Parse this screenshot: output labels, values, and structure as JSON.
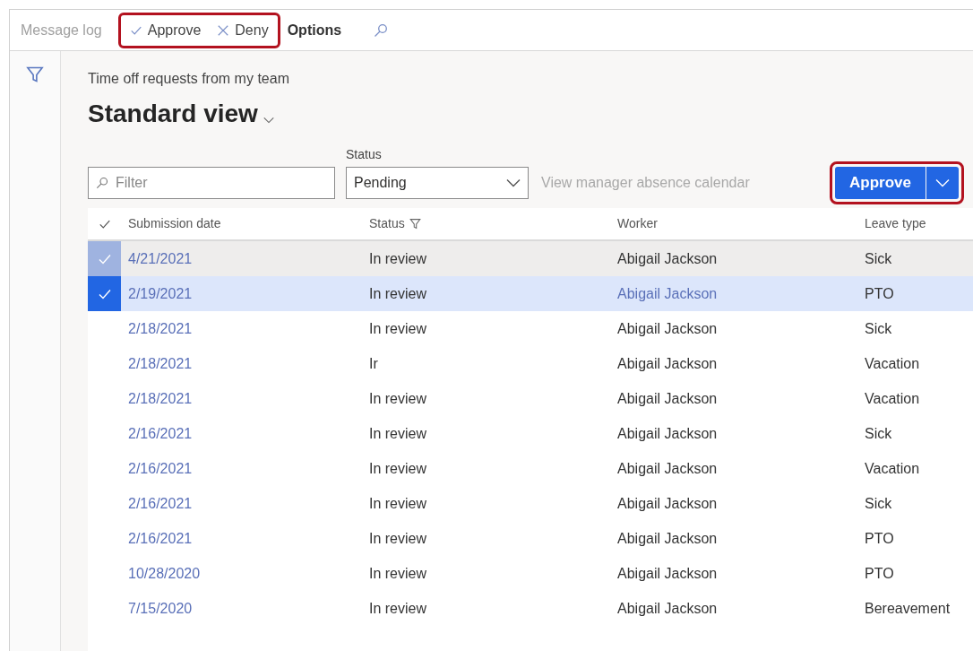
{
  "toolbar": {
    "message_log": "Message log",
    "highlighted": true,
    "approve": "Approve",
    "deny": "Deny",
    "options": "Options"
  },
  "page": {
    "caption": "Time off requests from my team",
    "view": "Standard view"
  },
  "filters": {
    "filter_placeholder": "Filter",
    "status_label": "Status",
    "status_value": "Pending",
    "calendar_link": "View manager absence calendar",
    "approve_button": "Approve",
    "highlighted": true
  },
  "table": {
    "columns": [
      "Submission date",
      "Status",
      "Worker",
      "Leave type"
    ],
    "rows": [
      {
        "date": "4/21/2021",
        "status": "In review",
        "worker": "Abigail Jackson",
        "leave": "Sick",
        "selected": false,
        "hovered": true
      },
      {
        "date": "2/19/2021",
        "status": "In review",
        "worker": "Abigail Jackson",
        "leave": "PTO",
        "selected": true,
        "hovered": false
      },
      {
        "date": "2/18/2021",
        "status": "In review",
        "worker": "Abigail Jackson",
        "leave": "Sick",
        "selected": false,
        "hovered": false
      },
      {
        "date": "2/18/2021",
        "status": "Ir",
        "worker": "Abigail Jackson",
        "leave": "Vacation",
        "selected": false,
        "hovered": false
      },
      {
        "date": "2/18/2021",
        "status": "In review",
        "worker": "Abigail Jackson",
        "leave": "Vacation",
        "selected": false,
        "hovered": false
      },
      {
        "date": "2/16/2021",
        "status": "In review",
        "worker": "Abigail Jackson",
        "leave": "Sick",
        "selected": false,
        "hovered": false
      },
      {
        "date": "2/16/2021",
        "status": "In review",
        "worker": "Abigail Jackson",
        "leave": "Vacation",
        "selected": false,
        "hovered": false
      },
      {
        "date": "2/16/2021",
        "status": "In review",
        "worker": "Abigail Jackson",
        "leave": "Sick",
        "selected": false,
        "hovered": false
      },
      {
        "date": "2/16/2021",
        "status": "In review",
        "worker": "Abigail Jackson",
        "leave": "PTO",
        "selected": false,
        "hovered": false
      },
      {
        "date": "10/28/2020",
        "status": "In review",
        "worker": "Abigail Jackson",
        "leave": "PTO",
        "selected": false,
        "hovered": false
      },
      {
        "date": "7/15/2020",
        "status": "In review",
        "worker": "Abigail Jackson",
        "leave": "Bereavement",
        "selected": false,
        "hovered": false
      }
    ]
  }
}
